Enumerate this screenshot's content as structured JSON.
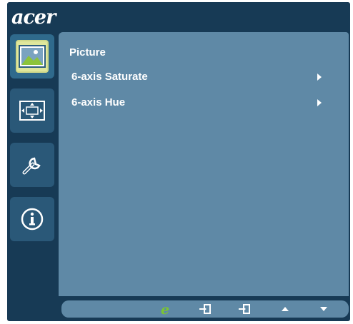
{
  "brand": {
    "logo_text": "acer"
  },
  "sidebar": {
    "items": [
      {
        "icon": "picture-icon",
        "active": true
      },
      {
        "icon": "display-position-icon",
        "active": false
      },
      {
        "icon": "settings-wrench-icon",
        "active": false
      },
      {
        "icon": "information-icon",
        "active": false
      }
    ]
  },
  "main": {
    "section_title": "Picture",
    "menu_items": [
      {
        "label": "6-axis Saturate",
        "icon": "chevron-right-icon"
      },
      {
        "label": "6-axis Hue",
        "icon": "chevron-right-icon"
      }
    ]
  },
  "bottom_bar": {
    "buttons": [
      {
        "icon": "e-key-icon"
      },
      {
        "icon": "enter-icon"
      },
      {
        "icon": "exit-icon"
      },
      {
        "icon": "up-arrow-icon"
      },
      {
        "icon": "down-arrow-icon"
      }
    ]
  },
  "colors": {
    "frame": "#173a55",
    "panel": "#5f89a6",
    "accent_green": "#7cc530",
    "text": "#ffffff"
  }
}
